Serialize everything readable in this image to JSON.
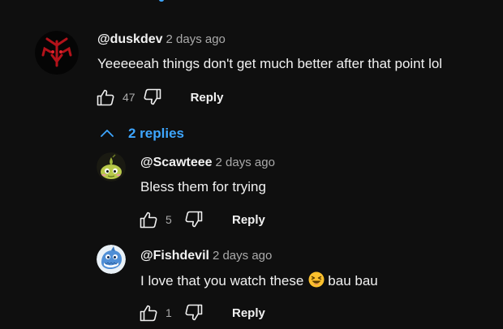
{
  "colors": {
    "background": "#0f0f0f",
    "text": "#f1f1f1",
    "muted": "#aaaaaa",
    "link": "#3ea6ff"
  },
  "comments": [
    {
      "handle": "@duskdev",
      "time": "2 days ago",
      "text": "Yeeeeeah things don't get much better after that point lol",
      "likes": "47",
      "reply_label": "Reply",
      "avatar_icon": "red-horned-mask-icon"
    }
  ],
  "replies_toggle": {
    "label": "2 replies",
    "icon": "chevron-up-icon"
  },
  "replies": [
    {
      "handle": "@Scawteee",
      "time": "2 days ago",
      "text": "Bless them for trying",
      "likes": "5",
      "reply_label": "Reply",
      "avatar_icon": "green-blob-creature-icon"
    },
    {
      "handle": "@Fishdevil",
      "time": "2 days ago",
      "text_before": "I love that you watch these",
      "emoji": "😆",
      "text_after": "bau bau",
      "likes": "1",
      "reply_label": "Reply",
      "avatar_icon": "blue-shark-character-icon"
    }
  ]
}
